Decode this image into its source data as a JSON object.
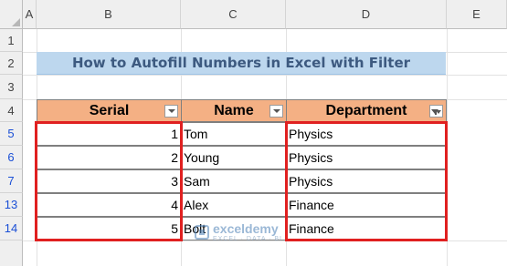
{
  "columns": [
    "A",
    "B",
    "C",
    "D",
    "E"
  ],
  "rows": [
    "1",
    "2",
    "3",
    "4",
    "5",
    "6",
    "7",
    "13",
    "14"
  ],
  "title": "How to Autofill Numbers in Excel with Filter",
  "table": {
    "headers": [
      "Serial",
      "Name",
      "Department"
    ],
    "data": [
      [
        "1",
        "Tom",
        "Physics"
      ],
      [
        "2",
        "Young",
        "Physics"
      ],
      [
        "3",
        "Sam",
        "Physics"
      ],
      [
        "4",
        "Alex",
        "Finance"
      ],
      [
        "5",
        "Bolt",
        "Finance"
      ]
    ]
  },
  "watermark": {
    "name": "exceldemy",
    "tagline": "EXCEL · DATA · BI"
  },
  "colors": {
    "header_fill": "#f4b084",
    "title_fill": "#bdd7ee",
    "highlight": "#e02020",
    "filtered_row_number": "#1a4fd6"
  }
}
